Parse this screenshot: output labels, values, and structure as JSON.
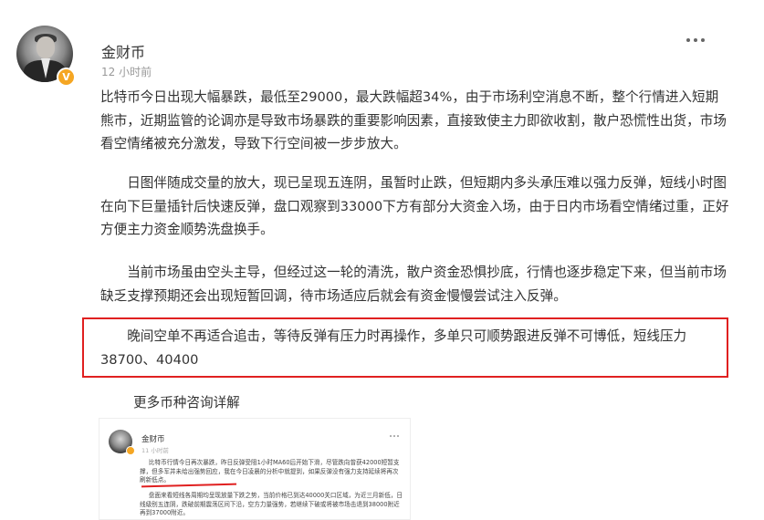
{
  "post": {
    "username": "金财币",
    "time": "12 小时前",
    "verified_badge": "V",
    "paragraphs": [
      "比特币今日出现大幅暴跌，最低至29000，最大跌幅超34%，由于市场利空消息不断，整个行情进入短期熊市，近期监管的论调亦是导致市场暴跌的重要影响因素，直接致使主力即欲收割，散户恐慌性出货，市场看空情绪被充分激发，导致下行空间被一步步放大。",
      "日图伴随成交量的放大，现已呈现五连阴，虽暂时止跌，但短期内多头承压难以强力反弹，短线小时图在向下巨量插针后快速反弹，盘口观察到33000下方有部分大资金入场，由于日内市场看空情绪过重，正好方便主力资金顺势洗盘换手。",
      "当前市场虽由空头主导，但经过这一轮的清洗，散户资金恐惧抄底，行情也逐步稳定下来，但当前市场缺乏支撑预期还会出现短暂回调，待市场适应后就会有资金慢慢尝试注入反弹。",
      "晚间空单不再适合追击，等待反弹有压力时再操作，多单只可顺势跟进反弹不可博低，短线压力38700、40400"
    ],
    "more_link": "更多币种咨询详解"
  },
  "thumbnail": {
    "username": "金财币",
    "time": "11 小时前",
    "paragraphs": [
      "比特币行情今日再次暴跌，昨日反弹受阻1小时MA60后开始下滑，尽管跌向曾获42000短暂支撑，但多军并未给出强势回应，我在今日凌晨的分析中就提到，如果反弹没有强力支持延续将再次刷新低点。",
      "盘面来看短线各周期均呈现放量下跌之势，当前价格已到达40000关口区域，为近三月新低，日线级别五连阴，跌破前期震荡区间下沿，空方力量强势，若继续下破或将被市场击退到38000附近再到37000附近。"
    ]
  },
  "colors": {
    "highlight_border": "#e02020",
    "badge": "#f5a623",
    "text": "#333333",
    "muted": "#999999"
  },
  "icons": [
    "avatar",
    "verified-badge-icon",
    "more-options-icon"
  ]
}
